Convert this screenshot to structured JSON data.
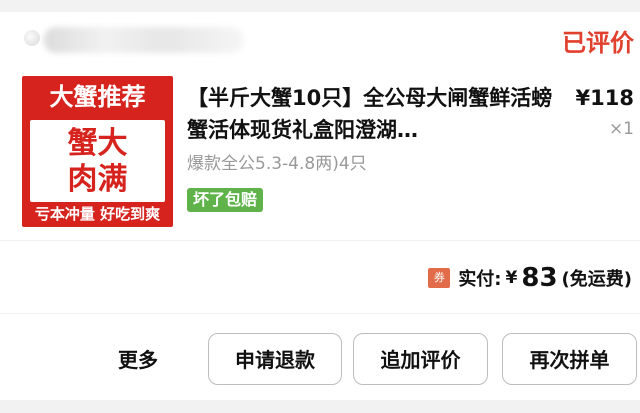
{
  "order": {
    "status": "已评价"
  },
  "product": {
    "thumbnail": {
      "banner": "大蟹推荐",
      "big_text": "蟹大\n肉满",
      "footer": "亏本冲量 好吃到爽"
    },
    "title": "【半斤大蟹10只】全公母大闸蟹鲜活螃蟹活体现货礼盒阳澄湖…",
    "spec": "爆款全公5.3-4.8两)4只",
    "guarantee_tag": "坏了包赔",
    "price": "¥118",
    "quantity": "×1"
  },
  "summary": {
    "coupon_icon_label": "券",
    "total_label": "实付:",
    "currency": "¥",
    "amount": "83",
    "shipping_note": "(免运费)"
  },
  "actions": {
    "more": "更多",
    "refund": "申请退款",
    "add_review": "追加评价",
    "rebuy": "再次拼单"
  },
  "colors": {
    "status": "#e0412f",
    "thumbnail_red": "#d6231e",
    "guarantee_green": "#5fb34a"
  }
}
